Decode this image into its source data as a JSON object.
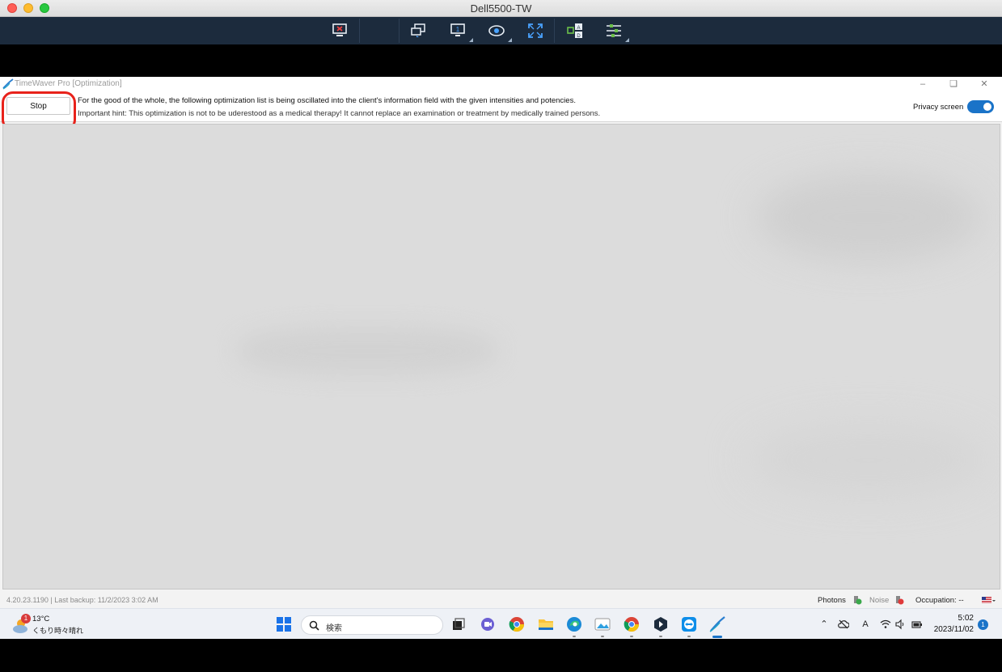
{
  "mac_window": {
    "title": "Dell5500-TW"
  },
  "remote_toolbar": {
    "icons": [
      "disconnect-icon",
      "actions-icon",
      "display-icon",
      "view-icon",
      "fullscreen-icon",
      "input-icon",
      "adjust-icon"
    ]
  },
  "app": {
    "title": "TimeWaver Pro [Optimization]",
    "stop_label": "Stop",
    "info_line1": "For the good of the whole, the following optimization list is being oscillated into the client's information field with the given intensities and potencies.",
    "info_line2": "Important hint: This optimization is not to be uderestood as a medical therapy! It cannot replace an examination or treatment by medically trained persons.",
    "privacy_label": "Privacy screen",
    "privacy_on": true,
    "accent_color": "#1a73c8",
    "highlight_color": "#e8221b"
  },
  "statusbar": {
    "version_backup": "4.20.23.1190  |  Last backup: 11/2/2023 3:02 AM",
    "photons_label": "Photons",
    "noise_label": "Noise",
    "occupation_label": "Occupation: --"
  },
  "taskbar": {
    "weather_badge": "1",
    "weather_temp": "13°C",
    "weather_desc": "くもり時々晴れ",
    "search_placeholder": "検索",
    "clock_time": "5:02",
    "clock_date": "2023/11/02",
    "notification_count": "1"
  }
}
